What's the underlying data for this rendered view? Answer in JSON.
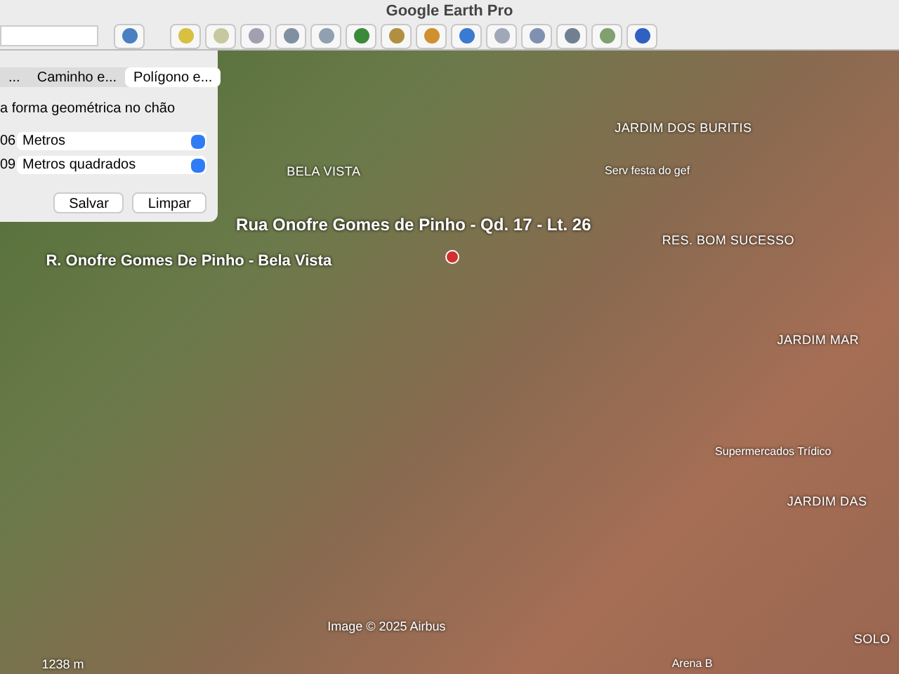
{
  "window": {
    "title": "Google Earth Pro"
  },
  "dialog": {
    "tabs": [
      {
        "label": "...",
        "selected": false
      },
      {
        "label": "Caminho e...",
        "selected": false
      },
      {
        "label": "Polígono e...",
        "selected": true
      }
    ],
    "description": "a forma geométrica no chão",
    "measurements": [
      {
        "value": "06",
        "unit": "Metros"
      },
      {
        "value": "09",
        "unit": "Metros quadrados"
      }
    ],
    "buttons": [
      "Salvar",
      "Limpar"
    ]
  },
  "map": {
    "labels": [
      {
        "text": "BELA VISTA",
        "kind": "area"
      },
      {
        "text": "JARDIM DOS BURITIS",
        "kind": "area"
      },
      {
        "text": "Serv festa do gef",
        "kind": "place"
      },
      {
        "text": "RES. BOM SUCESSO",
        "kind": "area"
      },
      {
        "text": "Rua Onofre Gomes de Pinho - Qd. 17 - Lt. 26",
        "kind": "pin"
      },
      {
        "text": "R. Onofre Gomes De Pinho - Bela Vista",
        "kind": "street"
      },
      {
        "text": "JARDIM MAR",
        "kind": "area"
      },
      {
        "text": "Supermercados Trídico",
        "kind": "place"
      },
      {
        "text": "JARDIM DAS",
        "kind": "area"
      },
      {
        "text": "SOLO",
        "kind": "area"
      },
      {
        "text": "Arena B",
        "kind": "place"
      },
      {
        "text": "Image © 2025 Airbus",
        "kind": "credit"
      },
      {
        "text": "1238 m",
        "kind": "credit"
      }
    ]
  }
}
